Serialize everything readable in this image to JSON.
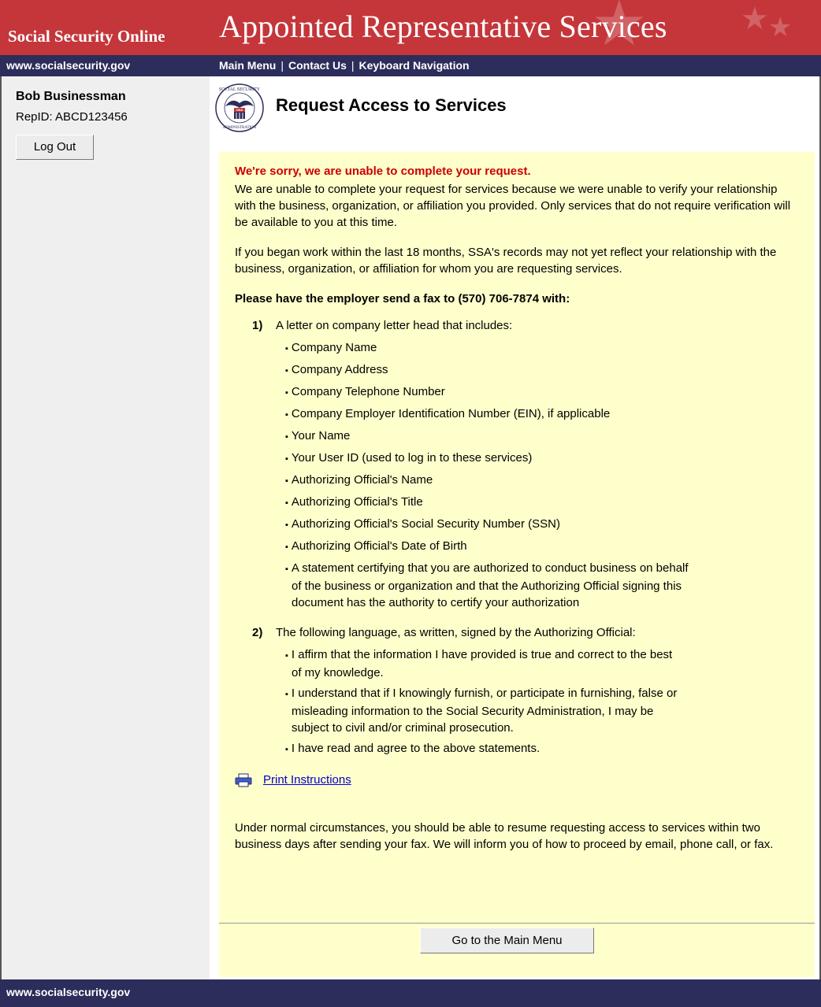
{
  "banner": {
    "site_name": "Social Security Online",
    "app_title": "Appointed Representative Services",
    "color": "#c4363a"
  },
  "navbar": {
    "site_url": "www.socialsecurity.gov",
    "main_menu": "Main Menu",
    "sep": "|",
    "contact_us": "Contact Us",
    "keyboard_navigation": "Keyboard Navigation",
    "color": "#2c2d5b"
  },
  "sidebar": {
    "user_name": "Bob Businessman",
    "rep_id": "RepID:  ABCD123456",
    "logout_label": "Log Out"
  },
  "seal": {
    "text_top": "SOCIAL SECURITY",
    "text_bottom": "ADMINISTRATION",
    "badge": "USA"
  },
  "page": {
    "title": "Request Access to Services"
  },
  "panel": {
    "error_title": "We're sorry, we are unable to complete your request.",
    "para1": "We are unable to complete your request for services because we were unable to verify your relationship with the business, organization, or affiliation you provided.  Only services that do not require verification will be available to you at this time.",
    "para2": "If you began work within the last 18 months, SSA's records may not yet reflect your relationship with the business, organization, or affiliation for whom you are requesting services.",
    "fax_heading": "Please have the employer send a fax to (570) 706-7874 with:",
    "step1_num": "1)",
    "step1_text": "A letter on company letter head that includes:",
    "step1_items": [
      "Company Name",
      "Company Address",
      "Company Telephone Number",
      "Company Employer Identification Number (EIN), if applicable",
      "Your Name",
      "Your User ID (used to log in to these services)",
      "Authorizing Official's Name",
      "Authorizing Official's Title",
      "Authorizing Official's Social Security Number (SSN)",
      "Authorizing Official's Date of Birth",
      "A statement certifying that you are authorized to conduct business on behalf of the business or organization and that the Authorizing Official signing this document has the authority to certify your authorization"
    ],
    "step2_num": "2)",
    "step2_text": "The following language, as written, signed by the Authorizing Official:",
    "step2_items": [
      "I affirm that the information I have provided is true and correct to the best of my knowledge.",
      "I understand that if I knowingly furnish, or participate in furnishing, false or misleading information to the Social Security Administration, I may be subject to civil and/or criminal prosecution.",
      "I have read and agree to the above statements."
    ],
    "print_label": "Print Instructions",
    "closing": "Under normal circumstances, you should be able to resume requesting access to services within two business days after sending your fax.  We will inform you of how to proceed by email, phone call, or fax.",
    "background": "#ffffcc",
    "error_color": "#cc0000"
  },
  "actions": {
    "main_menu_button": "Go to the Main Menu"
  },
  "footer": {
    "site_url": "www.socialsecurity.gov"
  }
}
